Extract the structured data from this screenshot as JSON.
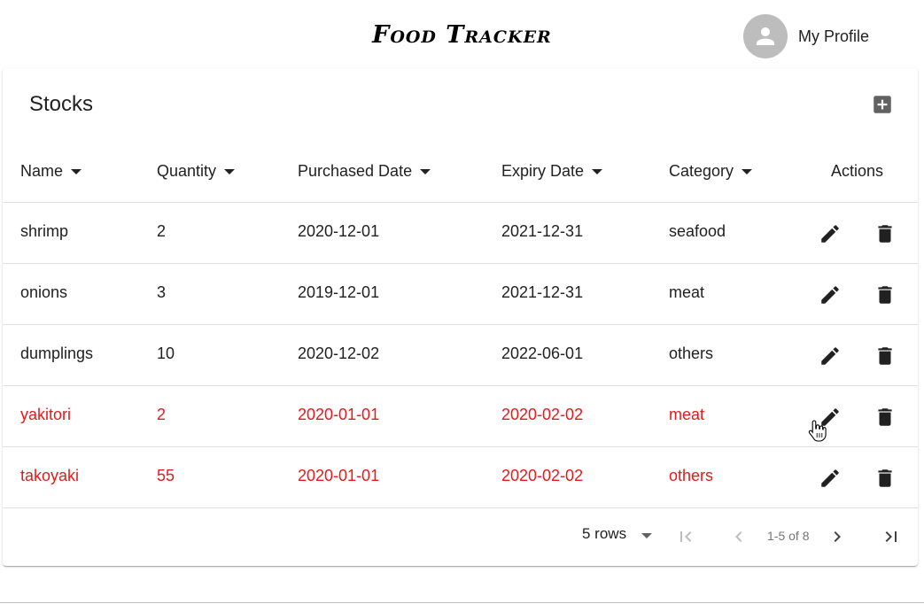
{
  "header": {
    "title": "Food Tracker",
    "profile_label": "My Profile"
  },
  "stocks": {
    "title": "Stocks",
    "columns": {
      "name": "Name",
      "quantity": "Quantity",
      "purchased_date": "Purchased Date",
      "expiry_date": "Expiry Date",
      "category": "Category",
      "actions": "Actions"
    },
    "rows": [
      {
        "name": "shrimp",
        "quantity": "2",
        "purchased_date": "2020-12-01",
        "expiry_date": "2021-12-31",
        "category": "seafood",
        "expired": false
      },
      {
        "name": "onions",
        "quantity": "3",
        "purchased_date": "2019-12-01",
        "expiry_date": "2021-12-31",
        "category": "meat",
        "expired": false
      },
      {
        "name": "dumplings",
        "quantity": "10",
        "purchased_date": "2020-12-02",
        "expiry_date": "2022-06-01",
        "category": "others",
        "expired": false
      },
      {
        "name": "yakitori",
        "quantity": "2",
        "purchased_date": "2020-01-01",
        "expiry_date": "2020-02-02",
        "category": "meat",
        "expired": true
      },
      {
        "name": "takoyaki",
        "quantity": "55",
        "purchased_date": "2020-01-01",
        "expiry_date": "2020-02-02",
        "category": "others",
        "expired": true
      }
    ]
  },
  "pagination": {
    "rows_per_page": "5 rows",
    "range_label": "1-5 of 8"
  },
  "colors": {
    "expired_text": "#e31b1b",
    "normal_text": "#212121",
    "avatar_bg": "#bdbdbd"
  },
  "icons": {
    "add": "add-box-icon",
    "edit": "pencil-icon",
    "delete": "trash-icon",
    "first_page": "first-page-icon",
    "prev_page": "chevron-left-icon",
    "next_page": "chevron-right-icon",
    "last_page": "last-page-icon"
  }
}
